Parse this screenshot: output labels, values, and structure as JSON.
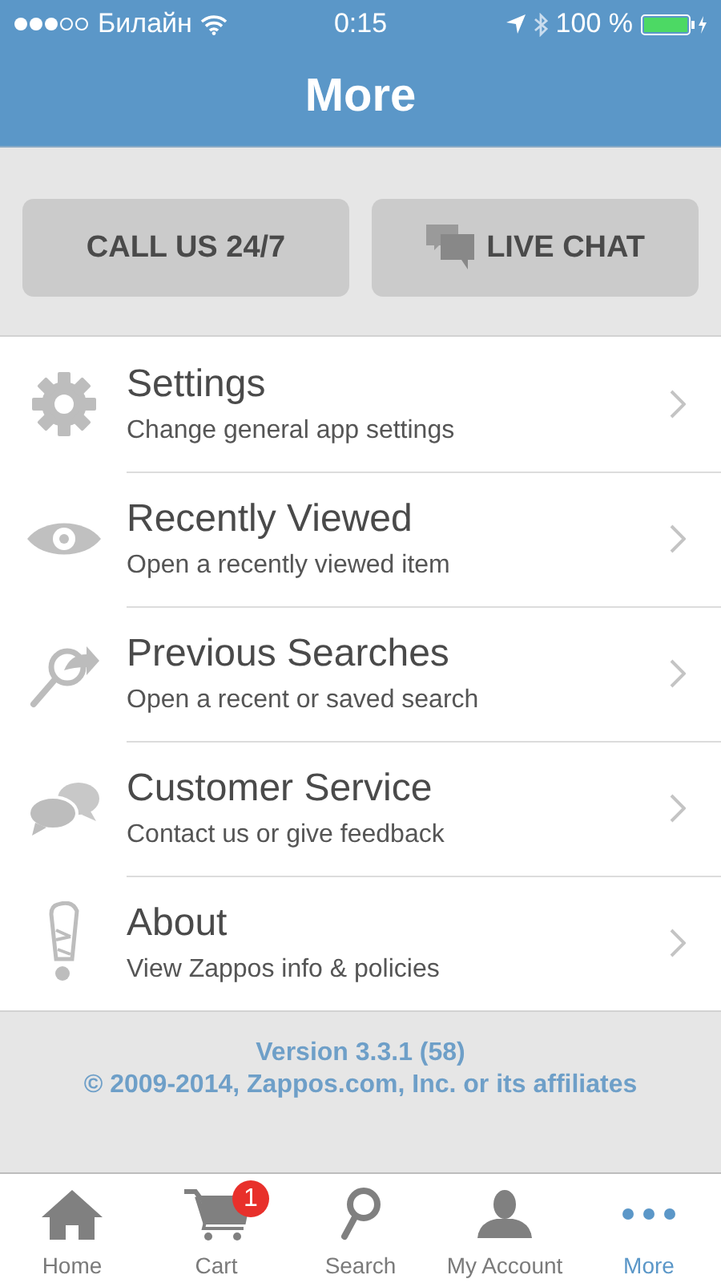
{
  "status_bar": {
    "carrier": "Билайн",
    "time": "0:15",
    "battery": "100 %"
  },
  "header": {
    "title": "More"
  },
  "contact_buttons": [
    {
      "label": "CALL US 24/7"
    },
    {
      "label": "LIVE CHAT"
    }
  ],
  "menu": [
    {
      "title": "Settings",
      "subtitle": "Change general app settings"
    },
    {
      "title": "Recently Viewed",
      "subtitle": "Open a recently viewed item"
    },
    {
      "title": "Previous Searches",
      "subtitle": "Open a recent or saved search"
    },
    {
      "title": "Customer Service",
      "subtitle": "Contact us or give feedback"
    },
    {
      "title": "About",
      "subtitle": "View Zappos info & policies"
    }
  ],
  "footer": {
    "version": "Version 3.3.1 (58)",
    "copyright": "© 2009-2014, Zappos.com, Inc. or its affiliates"
  },
  "tab_bar": [
    {
      "label": "Home",
      "selected": false
    },
    {
      "label": "Cart",
      "selected": false,
      "badge": "1"
    },
    {
      "label": "Search",
      "selected": false
    },
    {
      "label": "My Account",
      "selected": false
    },
    {
      "label": "More",
      "selected": true
    }
  ]
}
